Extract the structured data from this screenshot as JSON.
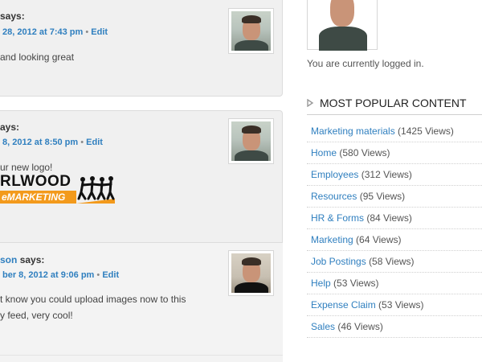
{
  "feed": {
    "comments": [
      {
        "author_suffix": "says:",
        "meta_date": "28, 2012 at 7:43 pm",
        "meta_sep": "•",
        "meta_edit": "Edit",
        "body": "and looking great"
      },
      {
        "author_suffix": "ays:",
        "meta_date": "8, 2012 at 8:50 pm",
        "meta_sep": "•",
        "meta_edit": "Edit",
        "body": "ur new logo!",
        "logo": {
          "wordmark": "RLWOOD",
          "sub": "eMARKETING"
        }
      },
      {
        "author_name": "son",
        "author_suffix": "says:",
        "meta_date": "ber 8, 2012 at 9:06 pm",
        "meta_sep": "•",
        "meta_edit": "Edit",
        "body_line1": "t know you could upload images now to this",
        "body_line2": "y feed, very cool!"
      }
    ]
  },
  "sidebar": {
    "logged_in_text": "You are currently logged in.",
    "widget_title": "MOST POPULAR CONTENT",
    "popular": [
      {
        "label": "Marketing materials",
        "views": "(1425 Views)"
      },
      {
        "label": "Home",
        "views": "(580 Views)"
      },
      {
        "label": "Employees",
        "views": "(312 Views)"
      },
      {
        "label": "Resources",
        "views": "(95 Views)"
      },
      {
        "label": "HR & Forms",
        "views": "(84 Views)"
      },
      {
        "label": "Marketing",
        "views": "(64 Views)"
      },
      {
        "label": "Job Postings",
        "views": "(58 Views)"
      },
      {
        "label": "Help",
        "views": "(53 Views)"
      },
      {
        "label": "Expense Claim",
        "views": "(53 Views)"
      },
      {
        "label": "Sales",
        "views": "(46 Views)"
      }
    ]
  },
  "colors": {
    "link": "#2f7fbf",
    "card_bg": "#f0f0f0",
    "logo_orange": "#f39a1c"
  }
}
